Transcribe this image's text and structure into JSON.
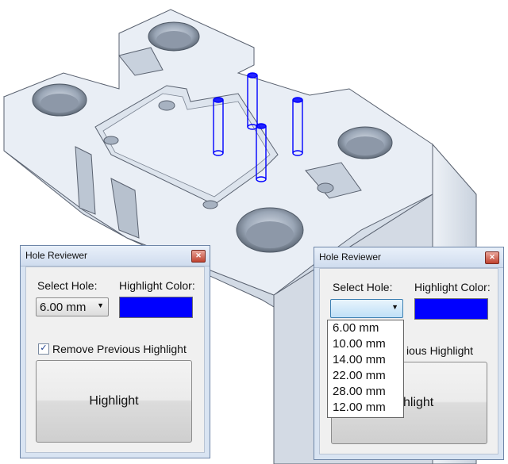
{
  "colors": {
    "highlight": "#0000ff",
    "model_face": "#e8eef6",
    "dialog_frame": "#d9e4f2"
  },
  "dialog_left": {
    "title": "Hole Reviewer",
    "close_icon": "close-x-icon",
    "select_hole_label": "Select Hole:",
    "select_hole_value": "6.00 mm",
    "highlight_color_label": "Highlight Color:",
    "remove_previous_checked": true,
    "remove_previous_label": "Remove Previous Highlight",
    "highlight_button": "Highlight"
  },
  "dialog_right": {
    "title": "Hole Reviewer",
    "close_icon": "close-x-icon",
    "select_hole_label": "Select Hole:",
    "select_hole_value": "",
    "highlight_color_label": "Highlight Color:",
    "remove_previous_label_visible": "ious Highlight",
    "highlight_button_visible": "hlight",
    "dropdown_options": [
      "6.00 mm",
      "10.00 mm",
      "14.00 mm",
      "22.00 mm",
      "28.00 mm",
      "12.00 mm"
    ]
  }
}
